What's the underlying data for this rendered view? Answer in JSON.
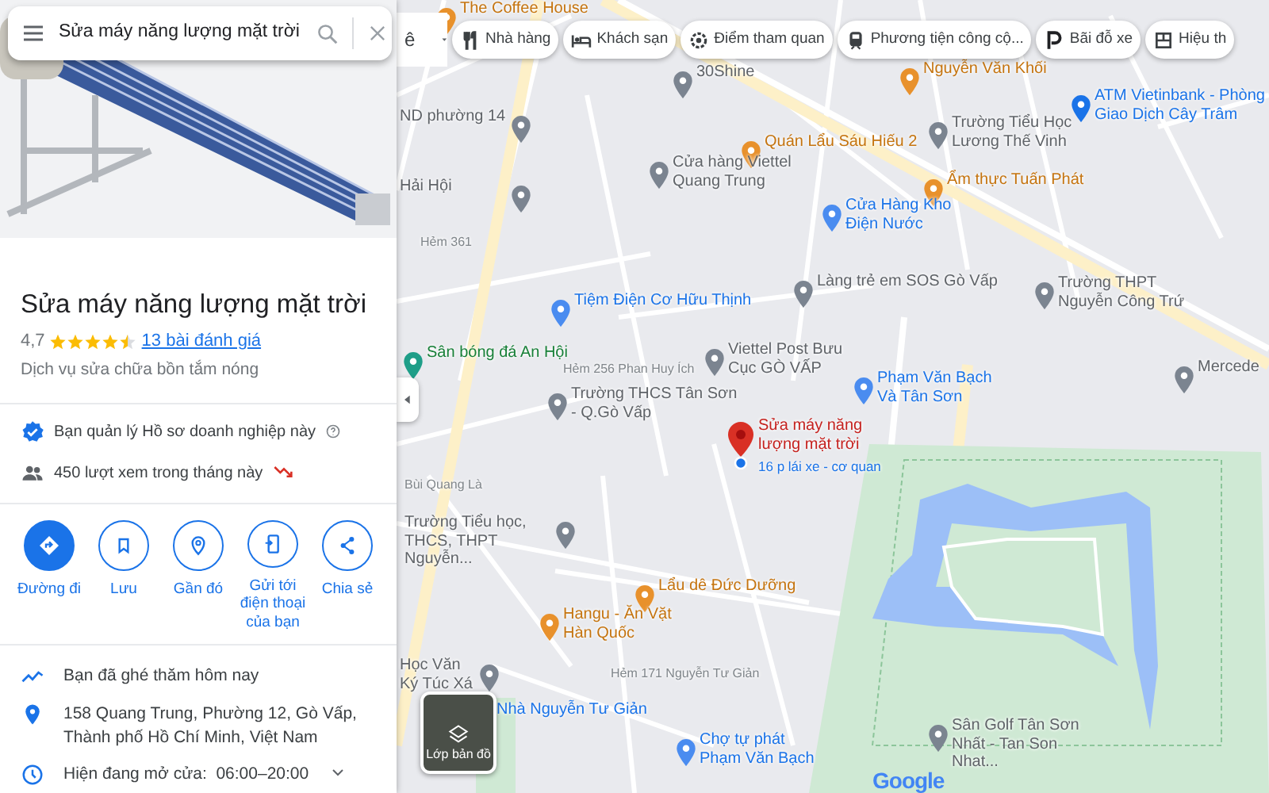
{
  "search": {
    "value": "Sửa máy năng lượng mặt trời"
  },
  "place": {
    "title": "Sửa máy năng lượng mặt trời",
    "rating": "4,7",
    "stars": 4.5,
    "reviews": "13 bài đánh giá",
    "category": "Dịch vụ sửa chữa bồn tắm nóng"
  },
  "owner_notes": [
    {
      "kind": "verified",
      "text": "Bạn quản lý Hồ sơ doanh nghiệp này"
    },
    {
      "kind": "views",
      "text": "450 lượt xem trong tháng này"
    }
  ],
  "actions": [
    {
      "label": "Đường đi",
      "kind": "directions",
      "selected": true
    },
    {
      "label": "Lưu",
      "kind": "save",
      "selected": false
    },
    {
      "label": "Gần đó",
      "kind": "nearby",
      "selected": false
    },
    {
      "label": "Gửi tới điện thoại của bạn",
      "kind": "phone",
      "selected": false
    },
    {
      "label": "Chia sẻ",
      "kind": "share",
      "selected": false
    }
  ],
  "info_rows": [
    {
      "kind": "visited",
      "text": "Bạn đã ghé thăm hôm nay"
    },
    {
      "kind": "address",
      "text": "158 Quang Trung, Phường 12, Gò Vấp, Thành phố Hồ Chí Minh, Việt Nam"
    },
    {
      "kind": "hours",
      "text": "Hiện đang mở cửa:  06:00–20:00"
    }
  ],
  "map": {
    "input_fragment": "ê",
    "chips": [
      {
        "kind": "restaurant",
        "label": "Nhà hàng"
      },
      {
        "kind": "hotel",
        "label": "Khách sạn"
      },
      {
        "kind": "attraction",
        "label": "Điểm tham quan"
      },
      {
        "kind": "transit",
        "label": "Phương tiện công cộ..."
      },
      {
        "kind": "parking",
        "label": "Bãi đỗ xe"
      },
      {
        "kind": "shop",
        "label": "Hiệu th"
      }
    ],
    "labels": [
      {
        "kind": "food",
        "text": "The Coffee House"
      },
      {
        "kind": "place",
        "text": "30Shine"
      },
      {
        "kind": "food",
        "text": "Nguyễn Văn Khối"
      },
      {
        "kind": "place",
        "text": "ND phường 14"
      },
      {
        "kind": "bank",
        "text": "ATM Vietinbank - Phòng Giao Dịch Cây Trâm"
      },
      {
        "kind": "food",
        "text": "Quán Lẩu Sáu Hiếu 2"
      },
      {
        "kind": "place",
        "text": "Trường Tiểu Học Lương Thế Vinh"
      },
      {
        "kind": "place",
        "text": "Hải Hội"
      },
      {
        "kind": "place",
        "text": "Cửa hàng Viettel Quang Trung"
      },
      {
        "kind": "food",
        "text": "Ẩm thực Tuấn Phát"
      },
      {
        "kind": "shop",
        "text": "Cửa Hàng Kho Điện Nước"
      },
      {
        "kind": "road",
        "text": "Hẻm 361"
      },
      {
        "kind": "shop",
        "text": "Tiệm Điện Cơ Hữu Thịnh"
      },
      {
        "kind": "place",
        "text": "Làng trẻ em SOS Gò Vấp"
      },
      {
        "kind": "place",
        "text": "Trường THPT Nguyễn Công Trứ"
      },
      {
        "kind": "park",
        "text": "Sân bóng đá An Hội"
      },
      {
        "kind": "road",
        "text": "Hẻm 256 Phan Huy Ích"
      },
      {
        "kind": "place",
        "text": "Viettel Post Bưu Cục GÒ VẤP"
      },
      {
        "kind": "place",
        "text": "Mercede"
      },
      {
        "kind": "place",
        "text": "Trường THCS Tân Sơn - Q.Gò Vấp"
      },
      {
        "kind": "shop",
        "text": "Phạm Văn Bạch Và Tân Sơn"
      },
      {
        "kind": "selected",
        "text": "Sửa máy năng lượng mặt trời"
      },
      {
        "kind": "note",
        "text": "16 p lái xe - cơ quan"
      },
      {
        "kind": "road",
        "text": "Bùi Quang Là"
      },
      {
        "kind": "place",
        "text": "Trường Tiểu học, THCS, THPT Nguyễn..."
      },
      {
        "kind": "food",
        "text": "Lẩu dê Đức Dưỡng"
      },
      {
        "kind": "food",
        "text": "Hangu - Ăn Vặt Hàn Quốc"
      },
      {
        "kind": "place",
        "text": "Học Văn Ký Túc Xá"
      },
      {
        "kind": "shop",
        "text": "Nhà Nguyễn Tư Giản"
      },
      {
        "kind": "road",
        "text": "Hẻm 171 Nguyễn Tư Giản"
      },
      {
        "kind": "shop",
        "text": "Chợ tự phát Phạm Văn Bạch"
      },
      {
        "kind": "place",
        "text": "Sân Golf Tân Sơn Nhất - Tan Son Nhat..."
      }
    ],
    "layers_button": "Lớp bản đồ",
    "logo": "Google"
  }
}
